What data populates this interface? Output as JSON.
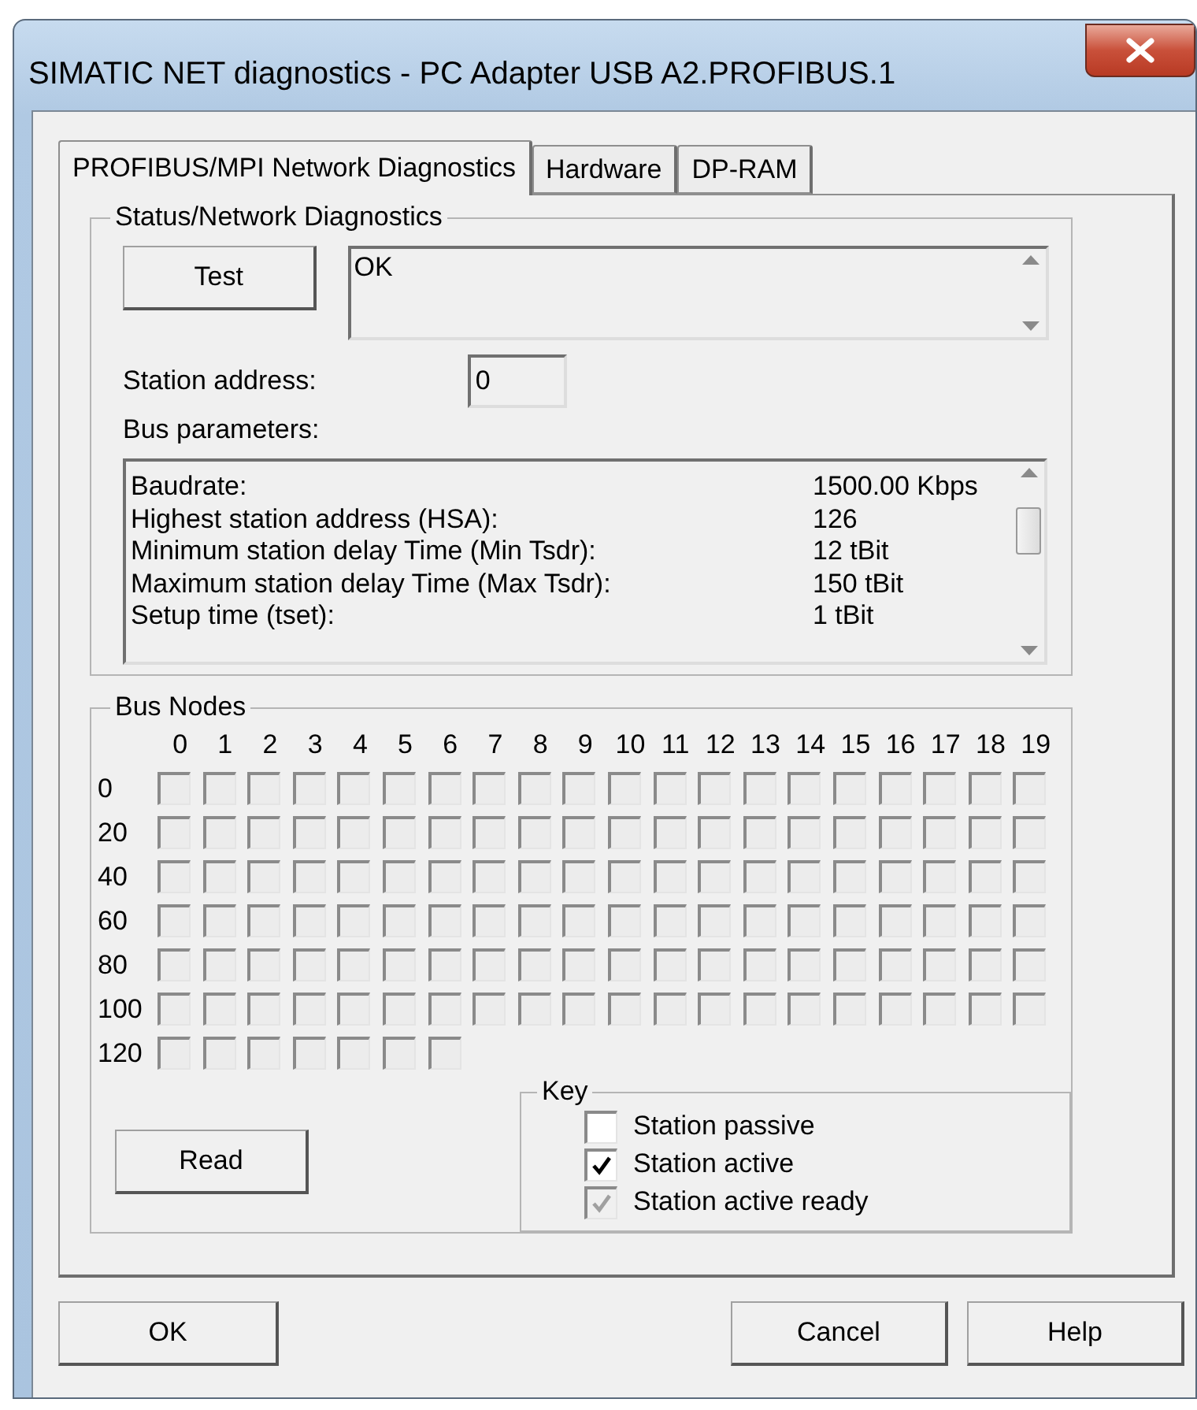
{
  "window": {
    "title": "SIMATIC NET diagnostics - PC Adapter USB A2.PROFIBUS.1"
  },
  "tabs": [
    {
      "label": "PROFIBUS/MPI Network Diagnostics",
      "selected": true
    },
    {
      "label": "Hardware",
      "selected": false
    },
    {
      "label": "DP-RAM",
      "selected": false
    }
  ],
  "status_group": {
    "title": "Status/Network Diagnostics",
    "test_button": "Test",
    "result": "OK",
    "station_address_label": "Station address:",
    "station_address": "0",
    "bus_parameters_label": "Bus parameters:",
    "bus_parameters": [
      {
        "name": "Baudrate:",
        "value": "1500.00 Kbps"
      },
      {
        "name": "Highest station address (HSA):",
        "value": "126"
      },
      {
        "name": "Minimum station delay Time (Min Tsdr):",
        "value": "12 tBit"
      },
      {
        "name": "Maximum station delay Time (Max Tsdr):",
        "value": "150 tBit"
      },
      {
        "name": "Setup time (tset):",
        "value": "1 tBit"
      }
    ]
  },
  "bus_nodes": {
    "title": "Bus Nodes",
    "columns": [
      "0",
      "1",
      "2",
      "3",
      "4",
      "5",
      "6",
      "7",
      "8",
      "9",
      "10",
      "11",
      "12",
      "13",
      "14",
      "15",
      "16",
      "17",
      "18",
      "19"
    ],
    "rows": [
      {
        "label": "0",
        "cells": [
          {
            "checked": false
          },
          {
            "checked": false
          },
          {
            "checked": false
          },
          {
            "checked": false
          },
          {
            "checked": false
          },
          {
            "checked": false
          },
          {
            "checked": false
          },
          {
            "checked": false
          },
          {
            "checked": false
          },
          {
            "checked": false
          },
          {
            "checked": false
          },
          {
            "checked": false
          },
          {
            "checked": false
          },
          {
            "checked": false
          },
          {
            "checked": false
          },
          {
            "checked": false
          },
          {
            "checked": false
          },
          {
            "checked": false
          },
          {
            "checked": false
          },
          {
            "checked": false
          }
        ]
      },
      {
        "label": "20",
        "cells": [
          {
            "checked": false
          },
          {
            "checked": false
          },
          {
            "checked": false
          },
          {
            "checked": false
          },
          {
            "checked": false
          },
          {
            "checked": false
          },
          {
            "checked": false
          },
          {
            "checked": false
          },
          {
            "checked": false
          },
          {
            "checked": false
          },
          {
            "checked": false
          },
          {
            "checked": false
          },
          {
            "checked": false
          },
          {
            "checked": false
          },
          {
            "checked": false
          },
          {
            "checked": false
          },
          {
            "checked": false
          },
          {
            "checked": false
          },
          {
            "checked": false
          },
          {
            "checked": false
          }
        ]
      },
      {
        "label": "40",
        "cells": [
          {
            "checked": false
          },
          {
            "checked": false
          },
          {
            "checked": false
          },
          {
            "checked": false
          },
          {
            "checked": false
          },
          {
            "checked": false
          },
          {
            "checked": false
          },
          {
            "checked": false
          },
          {
            "checked": false
          },
          {
            "checked": false
          },
          {
            "checked": false
          },
          {
            "checked": false
          },
          {
            "checked": false
          },
          {
            "checked": false
          },
          {
            "checked": false
          },
          {
            "checked": false
          },
          {
            "checked": false
          },
          {
            "checked": false
          },
          {
            "checked": false
          },
          {
            "checked": false
          }
        ]
      },
      {
        "label": "60",
        "cells": [
          {
            "checked": false
          },
          {
            "checked": false
          },
          {
            "checked": false
          },
          {
            "checked": false
          },
          {
            "checked": false
          },
          {
            "checked": false
          },
          {
            "checked": false
          },
          {
            "checked": false
          },
          {
            "checked": false
          },
          {
            "checked": false
          },
          {
            "checked": false
          },
          {
            "checked": false
          },
          {
            "checked": false
          },
          {
            "checked": false
          },
          {
            "checked": false
          },
          {
            "checked": false
          },
          {
            "checked": false
          },
          {
            "checked": false
          },
          {
            "checked": false
          },
          {
            "checked": false
          }
        ]
      },
      {
        "label": "80",
        "cells": [
          {
            "checked": false
          },
          {
            "checked": false
          },
          {
            "checked": false
          },
          {
            "checked": false
          },
          {
            "checked": false
          },
          {
            "checked": false
          },
          {
            "checked": false
          },
          {
            "checked": false
          },
          {
            "checked": false
          },
          {
            "checked": false
          },
          {
            "checked": false
          },
          {
            "checked": false
          },
          {
            "checked": false
          },
          {
            "checked": false
          },
          {
            "checked": false
          },
          {
            "checked": false
          },
          {
            "checked": false
          },
          {
            "checked": false
          },
          {
            "checked": false
          },
          {
            "checked": false
          }
        ]
      },
      {
        "label": "100",
        "cells": [
          {
            "checked": false
          },
          {
            "checked": false
          },
          {
            "checked": false
          },
          {
            "checked": false
          },
          {
            "checked": false
          },
          {
            "checked": false
          },
          {
            "checked": false
          },
          {
            "checked": false
          },
          {
            "checked": false
          },
          {
            "checked": false
          },
          {
            "checked": false
          },
          {
            "checked": false
          },
          {
            "checked": false
          },
          {
            "checked": false
          },
          {
            "checked": false
          },
          {
            "checked": false
          },
          {
            "checked": false
          },
          {
            "checked": false
          },
          {
            "checked": false
          },
          {
            "checked": false
          }
        ]
      },
      {
        "label": "120",
        "cells": [
          {
            "checked": false
          },
          {
            "checked": false
          },
          {
            "checked": false
          },
          {
            "checked": false
          },
          {
            "checked": false
          },
          {
            "checked": false
          },
          {
            "checked": false
          }
        ]
      }
    ],
    "read_button": "Read",
    "key": {
      "title": "Key",
      "items": [
        {
          "label": "Station passive",
          "checked": false,
          "disabled": false
        },
        {
          "label": "Station active",
          "checked": true,
          "disabled": false
        },
        {
          "label": "Station active ready",
          "checked": true,
          "disabled": true
        }
      ]
    }
  },
  "buttons": [
    {
      "label": "OK",
      "kind": "left"
    },
    {
      "label": "Cancel",
      "kind": "right"
    },
    {
      "label": "Help",
      "kind": "right"
    }
  ]
}
